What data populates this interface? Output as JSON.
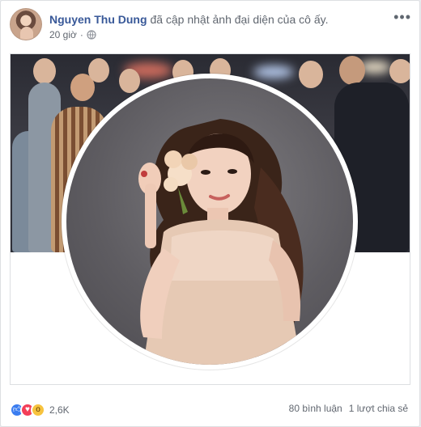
{
  "post": {
    "author": "Nguyen Thu Dung",
    "action": "đã cập nhật ảnh đại diện của cô ấy.",
    "time": "20 giờ",
    "audience_icon": "globe-icon",
    "more_icon": "more-options-icon"
  },
  "reactions": {
    "types": [
      "like",
      "love",
      "wow"
    ],
    "count": "2,6K"
  },
  "stats": {
    "comments": "80 bình luận",
    "shares": "1 lượt chia sẻ"
  },
  "colors": {
    "author": "#385898",
    "like": "#3b7df0",
    "love": "#f33e58",
    "wow": "#f7c33e"
  }
}
